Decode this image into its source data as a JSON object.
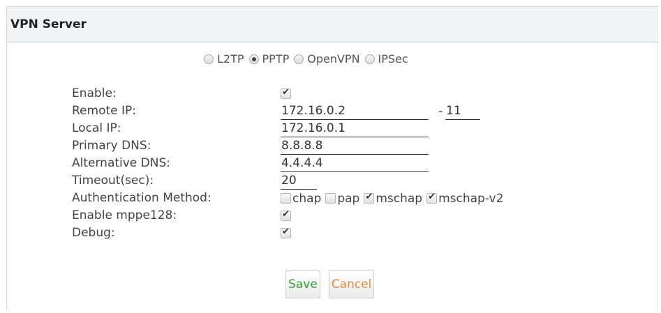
{
  "header": {
    "title": "VPN Server"
  },
  "protocols": [
    {
      "label": "L2TP",
      "selected": false
    },
    {
      "label": "PPTP",
      "selected": true
    },
    {
      "label": "OpenVPN",
      "selected": false
    },
    {
      "label": "IPSec",
      "selected": false
    }
  ],
  "form": {
    "enable": {
      "label": "Enable:",
      "checked": true
    },
    "remote_ip": {
      "label": "Remote IP:",
      "value": "172.16.0.2",
      "dash": "-",
      "end_value": "11"
    },
    "local_ip": {
      "label": "Local IP:",
      "value": "172.16.0.1"
    },
    "primary_dns": {
      "label": "Primary DNS:",
      "value": "8.8.8.8"
    },
    "alternative_dns": {
      "label": "Alternative DNS:",
      "value": "4.4.4.4"
    },
    "timeout": {
      "label": "Timeout(sec):",
      "value": "20"
    },
    "auth": {
      "label": "Authentication Method:",
      "options": [
        {
          "label": "chap",
          "checked": false
        },
        {
          "label": "pap",
          "checked": false
        },
        {
          "label": "mschap",
          "checked": true
        },
        {
          "label": "mschap-v2",
          "checked": true
        }
      ]
    },
    "mppe128": {
      "label": "Enable mppe128:",
      "checked": true
    },
    "debug": {
      "label": "Debug:",
      "checked": true
    }
  },
  "buttons": {
    "save": "Save",
    "cancel": "Cancel"
  },
  "colors": {
    "header_bg": "#f0f4f8",
    "save_text": "#2e9e2e",
    "cancel_text": "#e8893a"
  }
}
